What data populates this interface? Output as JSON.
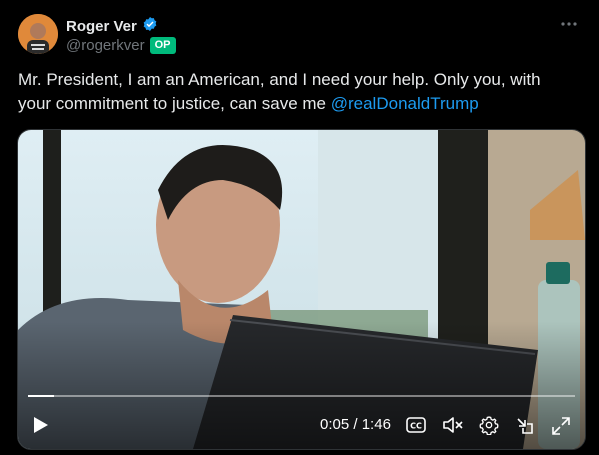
{
  "author": {
    "name": "Roger Ver",
    "handle": "@rogerkver",
    "badge": "OP",
    "verified": true
  },
  "tweet": {
    "text_before": "Mr. President, I am an American, and I need your help. Only you, with your commitment to justice, can save me ",
    "mention": "@realDonaldTrump"
  },
  "video": {
    "current_time": "0:05",
    "separator": " / ",
    "duration": "1:46",
    "progress_fraction": 0.047
  },
  "colors": {
    "background": "#000000",
    "mention": "#1d9bf0",
    "badge": "#00ba7c",
    "verified": "#1d9bf0"
  },
  "icons": [
    "verified-badge-icon",
    "more-icon",
    "play-icon",
    "captions-icon",
    "mute-icon",
    "settings-icon",
    "picture-in-picture-icon",
    "fullscreen-icon"
  ]
}
